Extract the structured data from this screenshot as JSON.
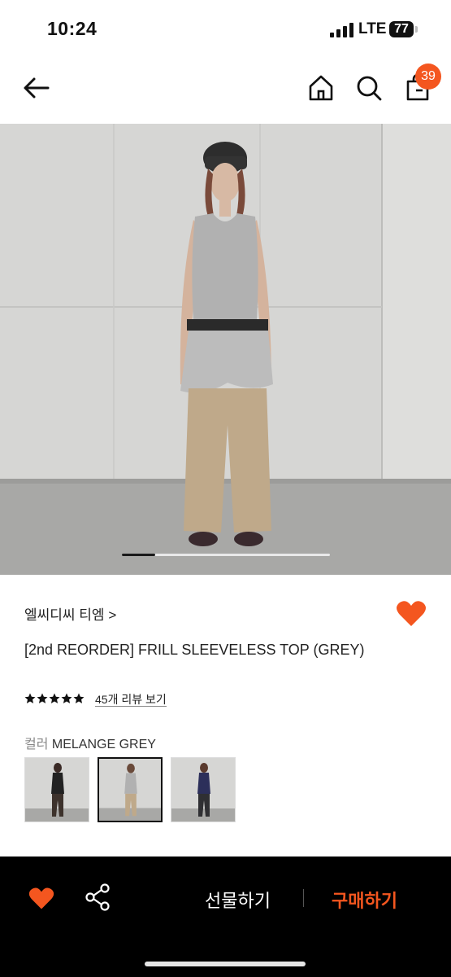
{
  "status_bar": {
    "time": "10:24",
    "network": "LTE",
    "battery": "77"
  },
  "nav": {
    "cart_count": "39"
  },
  "product": {
    "brand": "엘씨디씨 티엠",
    "brand_chevron": ">",
    "title": "[2nd REORDER] FRILL SLEEVELESS TOP (GREY)",
    "rating": 5,
    "review_link": "45개 리뷰 보기",
    "color_label": "컬러",
    "color_value": "MELANGE GREY",
    "gallery_progress": 0.16,
    "color_options": [
      "black",
      "melange grey",
      "navy"
    ],
    "selected_color_index": 1
  },
  "bottom_bar": {
    "gift_label": "선물하기",
    "buy_label": "구매하기"
  },
  "colors": {
    "accent": "#f4561f",
    "bar": "#000000"
  }
}
